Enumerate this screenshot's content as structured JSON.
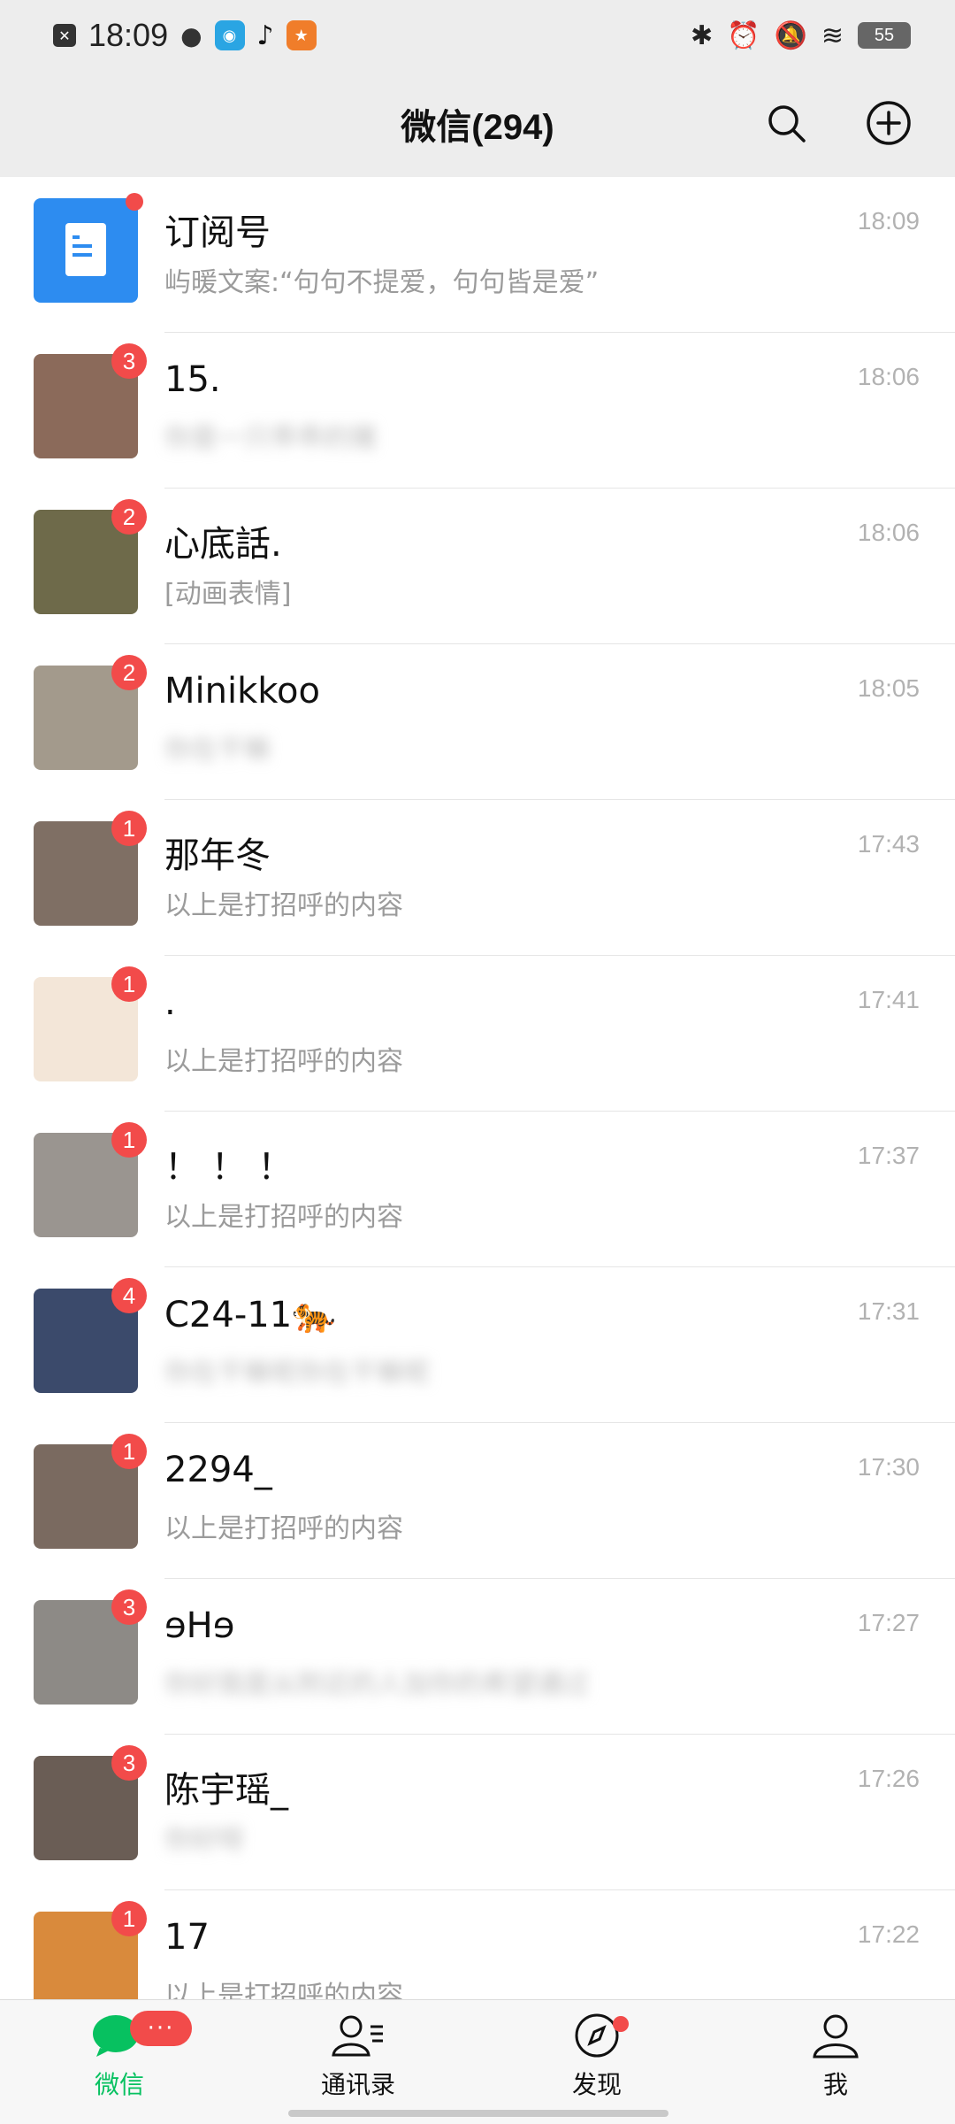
{
  "status": {
    "time": "18:09",
    "battery": "55",
    "apps": [
      "close-app-icon",
      "chat-bubble-icon",
      "radio-app-icon",
      "tiktok-icon",
      "game-app-icon"
    ]
  },
  "header": {
    "title": "微信(294)"
  },
  "chats": [
    {
      "name": "订阅号",
      "preview": "屿暖文案:“句句不提爱，句句皆是爱”",
      "time": "18:09",
      "badge": "",
      "dot": true,
      "blurred": false,
      "avatar_color": "#2d8cf0"
    },
    {
      "name": "15.",
      "preview": "你是一只乖乖的猪",
      "time": "18:06",
      "badge": "3",
      "dot": false,
      "blurred": true,
      "avatar_color": "#8b6a5a"
    },
    {
      "name": "心底話.",
      "preview": "[动画表情]",
      "time": "18:06",
      "badge": "2",
      "dot": false,
      "blurred": false,
      "avatar_color": "#6e6a4a"
    },
    {
      "name": "Minikkoo",
      "preview": "你在干嘛",
      "time": "18:05",
      "badge": "2",
      "dot": false,
      "blurred": true,
      "avatar_color": "#a39a8c"
    },
    {
      "name": "那年冬",
      "preview": "以上是打招呼的内容",
      "time": "17:43",
      "badge": "1",
      "dot": false,
      "blurred": false,
      "avatar_color": "#7f6f64"
    },
    {
      "name": ".",
      "preview": "以上是打招呼的内容",
      "time": "17:41",
      "badge": "1",
      "dot": false,
      "blurred": false,
      "avatar_color": "#f3e6d8"
    },
    {
      "name": "！ ！ ！",
      "preview": "以上是打招呼的内容",
      "time": "17:37",
      "badge": "1",
      "dot": false,
      "blurred": false,
      "avatar_color": "#9a9590"
    },
    {
      "name": "C24-11🐅",
      "preview": "你在干嘛呢你在干嘛呢",
      "time": "17:31",
      "badge": "4",
      "dot": false,
      "blurred": true,
      "avatar_color": "#3b4a6b"
    },
    {
      "name": "2294_",
      "preview": "以上是打招呼的内容",
      "time": "17:30",
      "badge": "1",
      "dot": false,
      "blurred": false,
      "avatar_color": "#7a6a60"
    },
    {
      "name": "ɘHɘ",
      "preview": "你好我是从附近的人加你的希望通过",
      "time": "17:27",
      "badge": "3",
      "dot": false,
      "blurred": true,
      "avatar_color": "#8d8a86"
    },
    {
      "name": "陈宇瑶_",
      "preview": "你好呀",
      "time": "17:26",
      "badge": "3",
      "dot": false,
      "blurred": true,
      "avatar_color": "#6a5d55"
    },
    {
      "name": "17",
      "preview": "以上是打招呼的内容",
      "time": "17:22",
      "badge": "1",
      "dot": false,
      "blurred": false,
      "avatar_color": "#d98a3c"
    }
  ],
  "tabs": [
    {
      "label": "微信",
      "icon": "chat-icon",
      "active": true,
      "badge": "···"
    },
    {
      "label": "通讯录",
      "icon": "contacts-icon",
      "active": false,
      "badge": ""
    },
    {
      "label": "发现",
      "icon": "compass-icon",
      "active": false,
      "badge": "dot"
    },
    {
      "label": "我",
      "icon": "profile-icon",
      "active": false,
      "badge": ""
    }
  ],
  "colors": {
    "accent": "#07c160",
    "badge": "#f24b4a"
  }
}
